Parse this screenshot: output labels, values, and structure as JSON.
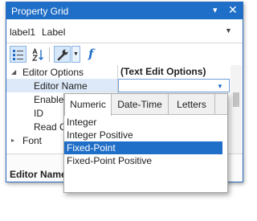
{
  "window": {
    "title": "Property Grid",
    "pin_glyph": "▾",
    "close_glyph": "✕"
  },
  "object_selector": {
    "name": "label1",
    "type": "Label",
    "dropdown_glyph": "▼"
  },
  "toolbar": {
    "buttons": [
      {
        "icon": "categorized-icon",
        "pressed": true
      },
      {
        "icon": "sort-alphabetical-icon",
        "pressed": false
      },
      {
        "icon": "wrench-icon",
        "pressed": true
      }
    ],
    "dropdown_glyph": "▼",
    "fx_label": "f"
  },
  "grid": {
    "rows": [
      {
        "name": "Editor Options",
        "value": "(Text Edit Options)",
        "expand_glyph": "◢"
      },
      {
        "name": "Editor Name",
        "value": ""
      },
      {
        "name": "Enabled",
        "value": ""
      },
      {
        "name": "ID",
        "value": ""
      },
      {
        "name": "Read O",
        "value": ""
      },
      {
        "name": "Font",
        "value": "",
        "expand_glyph": "▸"
      }
    ],
    "editor_arrow_glyph": "▼"
  },
  "description": {
    "title": "Editor Name"
  },
  "popup": {
    "tabs": [
      "Numeric",
      "Date-Time",
      "Letters"
    ],
    "active_tab": "Numeric",
    "items": [
      "Integer",
      "Integer Positive",
      "Fixed-Point",
      "Fixed-Point Positive"
    ],
    "selected_item": "Fixed-Point"
  },
  "colors": {
    "accent": "#1f6ec7",
    "selection_light": "#dde9f8"
  }
}
